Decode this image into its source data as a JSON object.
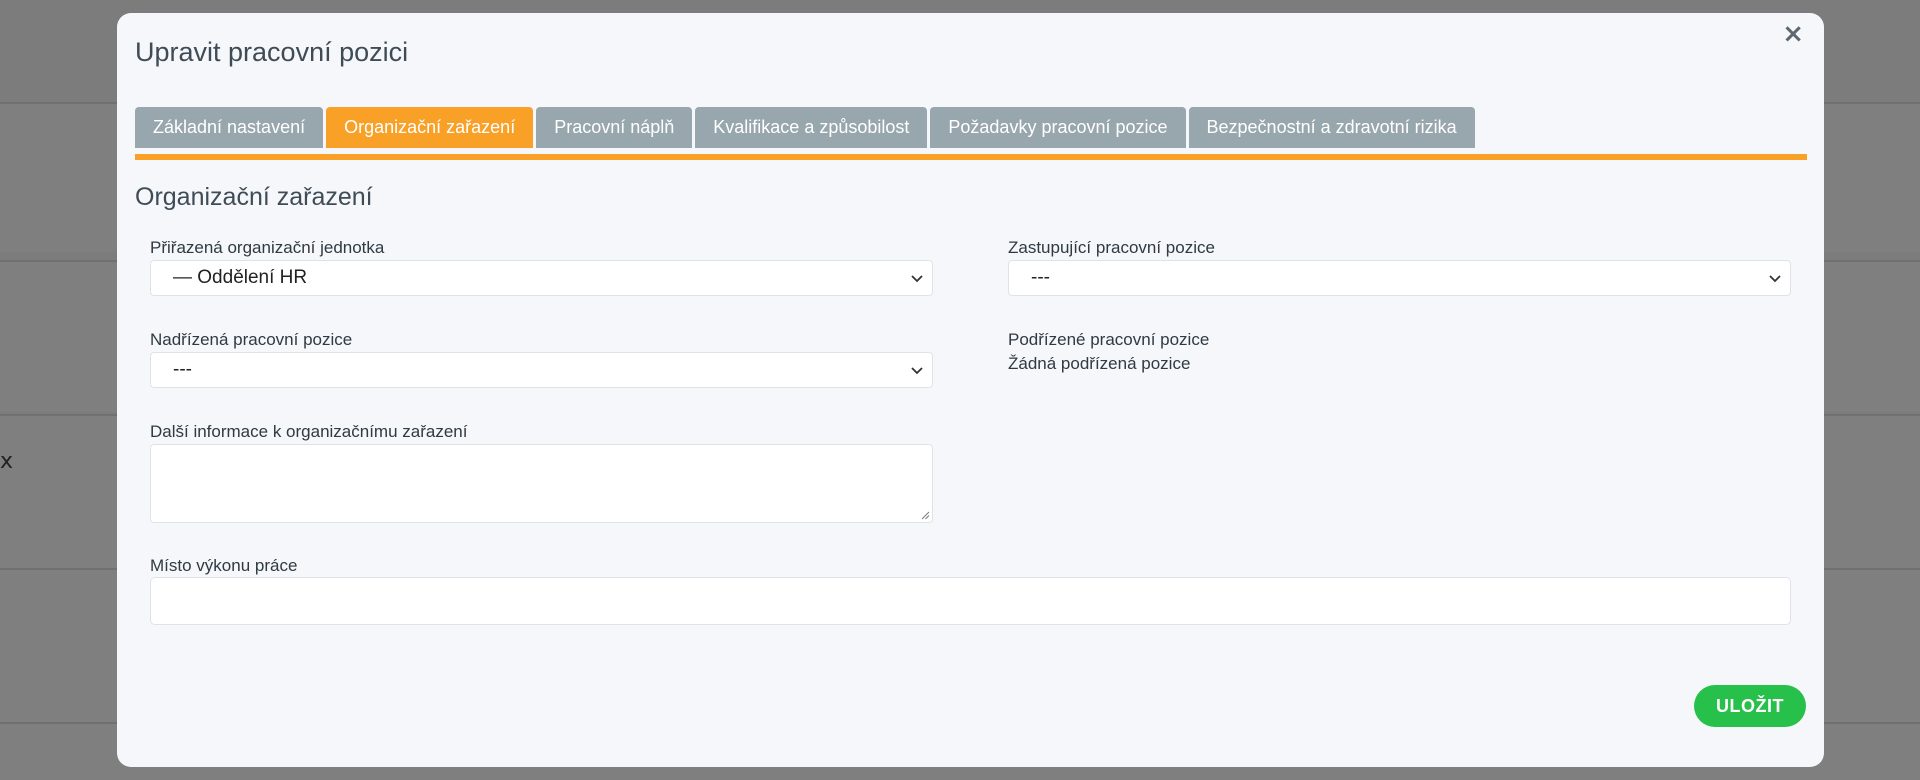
{
  "background": {
    "left_glyph": "x"
  },
  "modal": {
    "title": "Upravit pracovní pozici",
    "close_symbol": "×"
  },
  "tabs": [
    {
      "label": "Základní nastavení",
      "active": false
    },
    {
      "label": "Organizační zařazení",
      "active": true
    },
    {
      "label": "Pracovní náplň",
      "active": false
    },
    {
      "label": "Kvalifikace a způsobilost",
      "active": false
    },
    {
      "label": "Požadavky pracovní pozice",
      "active": false
    },
    {
      "label": "Bezpečnostní a zdravotní rizika",
      "active": false
    }
  ],
  "section": {
    "title": "Organizační zařazení"
  },
  "fields": {
    "org_unit": {
      "label": "Přiřazená organizační jednotka",
      "value": "— Oddělení HR"
    },
    "substitute_position": {
      "label": "Zastupující pracovní pozice",
      "value": "---"
    },
    "superior_position": {
      "label": "Nadřízená pracovní pozice",
      "value": "---"
    },
    "subordinate_positions": {
      "label": "Podřízené pracovní pozice",
      "value": "Žádná podřízená pozice"
    },
    "additional_info": {
      "label": "Další informace k organizačnímu zařazení",
      "value": ""
    },
    "work_location": {
      "label": "Místo výkonu práce",
      "value": ""
    }
  },
  "actions": {
    "save_label": "ULOŽIT"
  },
  "colors": {
    "accent": "#f9a027",
    "tab_inactive": "#98a7ae",
    "save": "#27c04a",
    "overlay": "#7c7c7c"
  },
  "icons": {
    "close": "close-icon",
    "dropdown": "chevron-down-icon",
    "resize": "resize-handle-icon"
  }
}
